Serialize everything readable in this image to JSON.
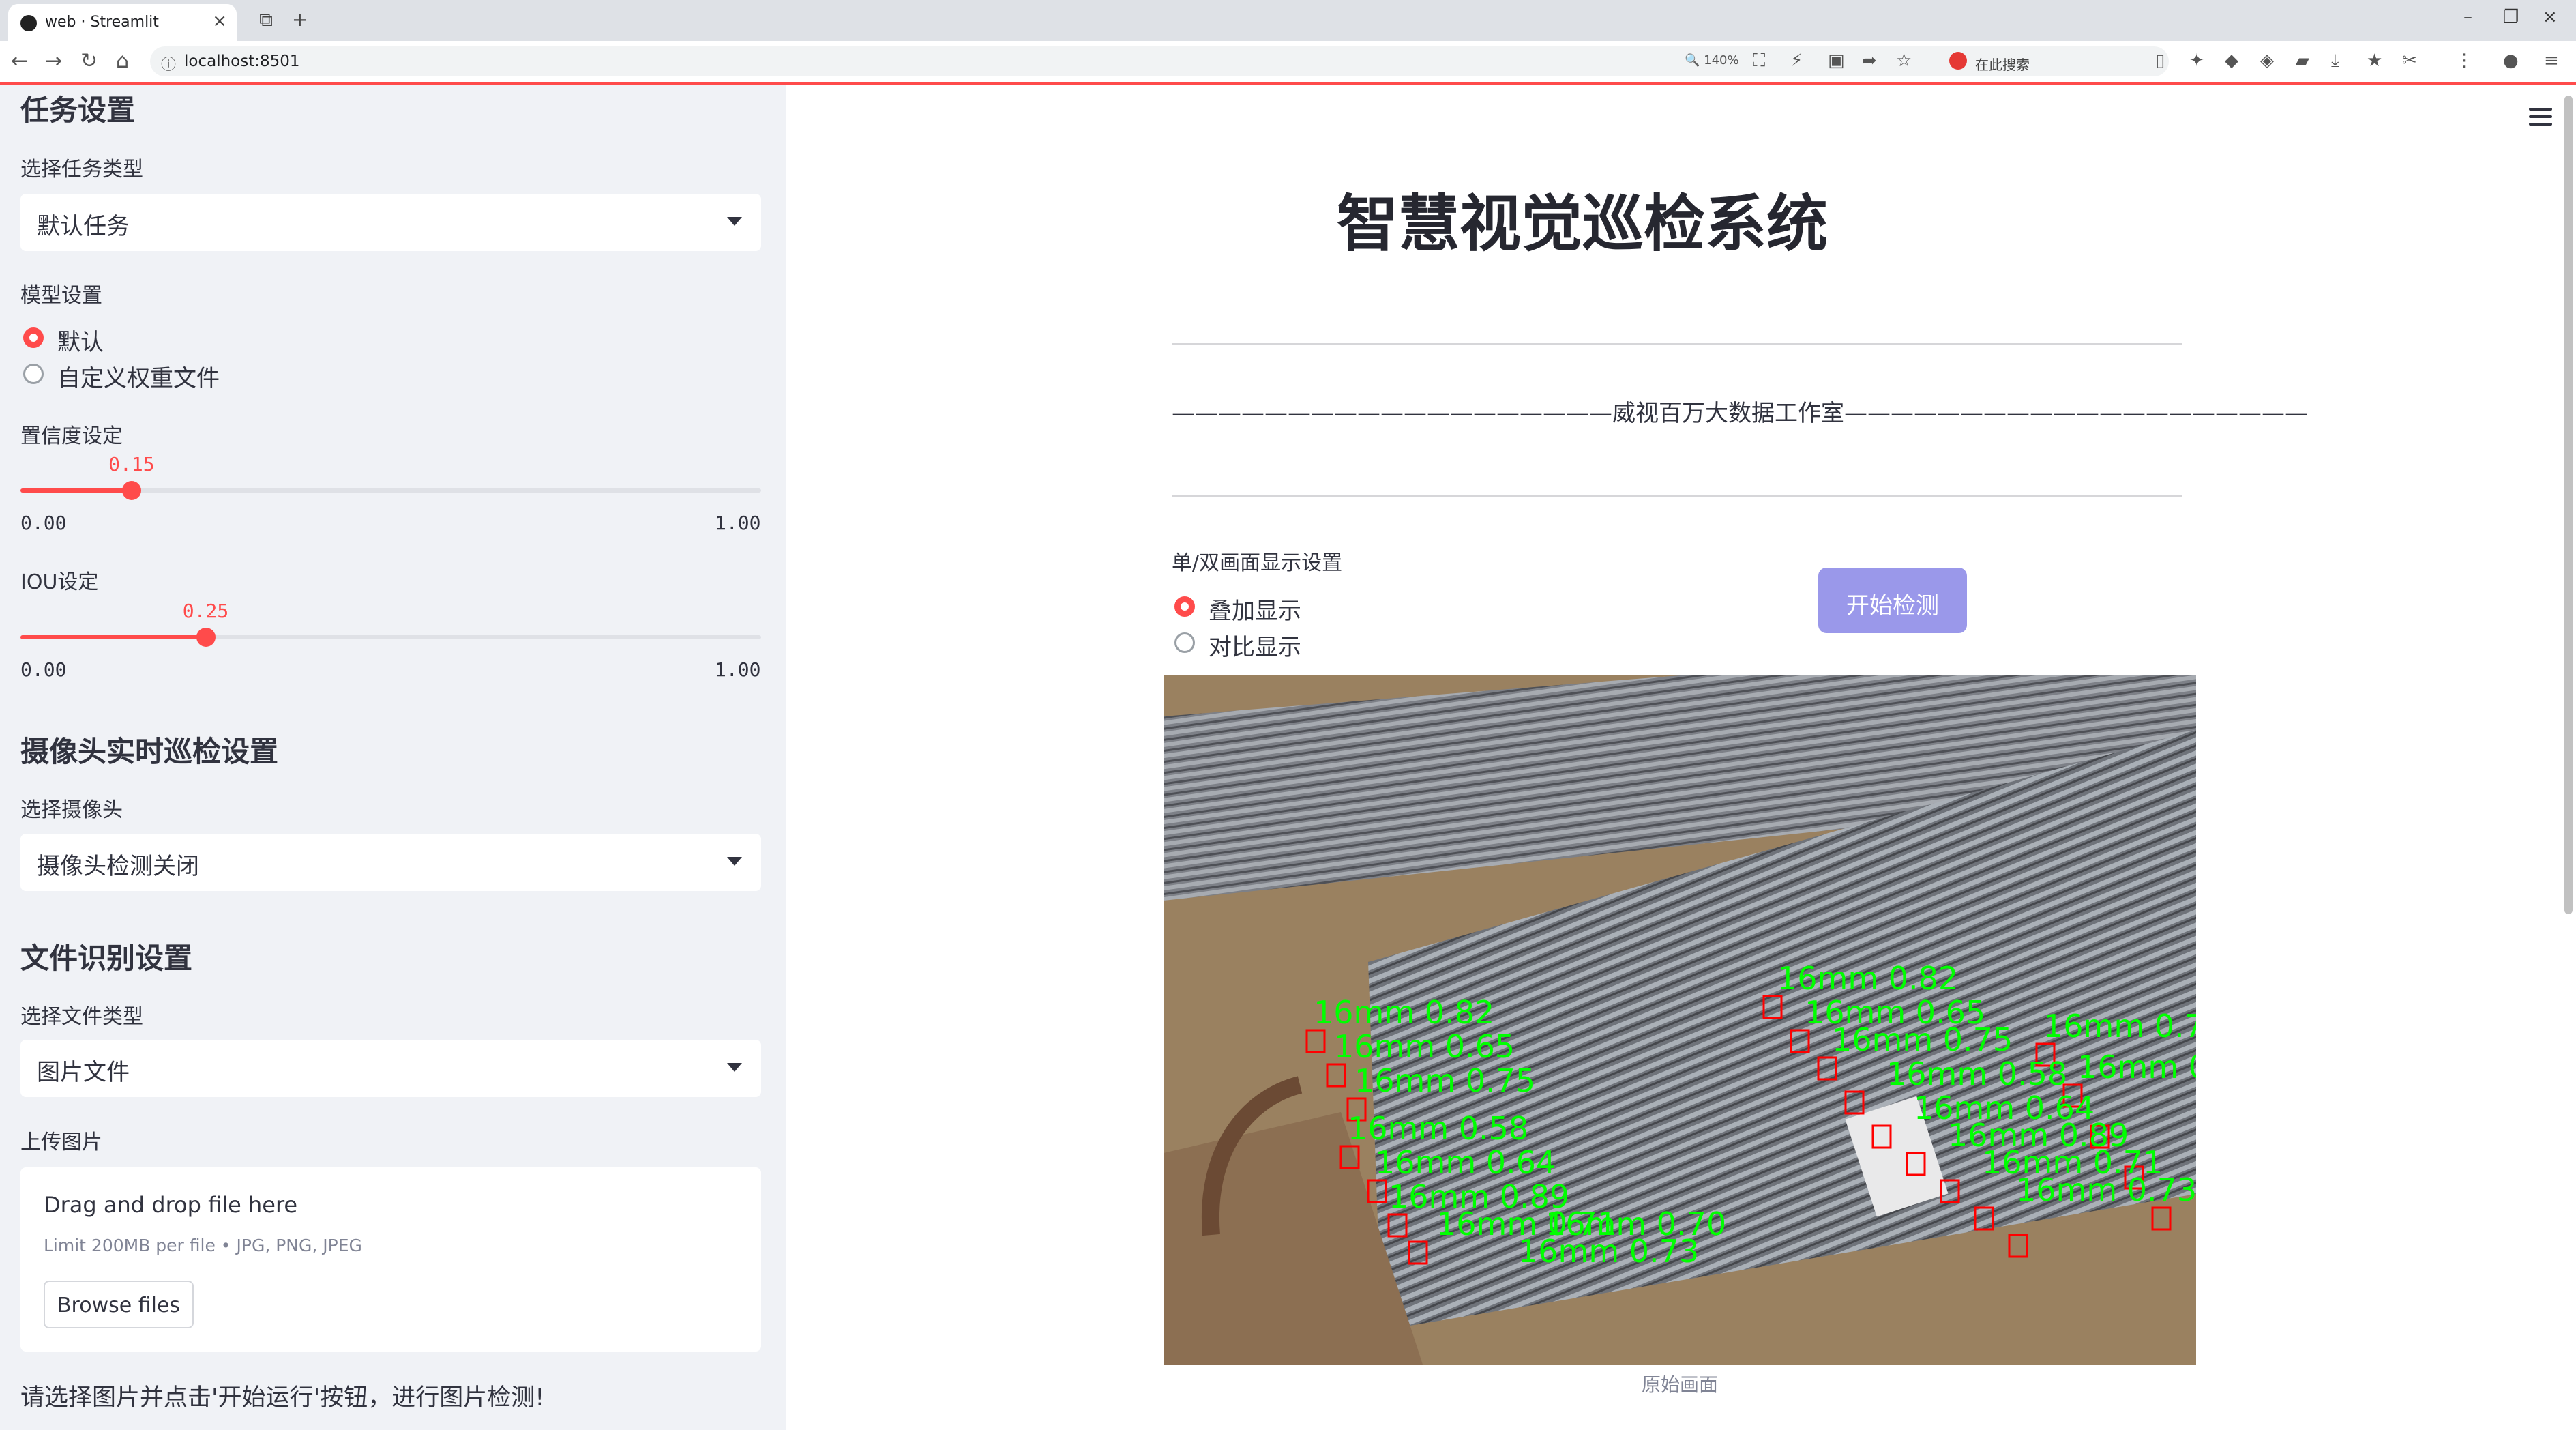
{
  "browser": {
    "tab_title": "web · Streamlit",
    "url": "localhost:8501",
    "zoom": "140%",
    "search_placeholder": "在此搜索"
  },
  "sidebar": {
    "task_section": {
      "title": "任务设置",
      "select_label": "选择任务类型",
      "select_value": "默认任务"
    },
    "model_section": {
      "label": "模型设置",
      "options": [
        {
          "label": "默认",
          "selected": true
        },
        {
          "label": "自定义权重文件",
          "selected": false
        }
      ]
    },
    "confidence": {
      "label": "置信度设定",
      "value": 0.15,
      "value_text": "0.15",
      "min": "0.00",
      "max": "1.00"
    },
    "iou": {
      "label": "IOU设定",
      "value": 0.25,
      "value_text": "0.25",
      "min": "0.00",
      "max": "1.00"
    },
    "camera_section": {
      "title": "摄像头实时巡检设置",
      "select_label": "选择摄像头",
      "select_value": "摄像头检测关闭"
    },
    "file_section": {
      "title": "文件识别设置",
      "select_label": "选择文件类型",
      "select_value": "图片文件",
      "upload_label": "上传图片",
      "drop_text": "Drag and drop file here",
      "limit_text": "Limit 200MB per file • JPG, PNG, JPEG",
      "browse_label": "Browse files"
    },
    "hint": "请选择图片并点击'开始运行'按钮，进行图片检测!"
  },
  "main": {
    "title": "智慧视觉巡检系统",
    "subtitle": "———————————————————威视百万大数据工作室————————————————————",
    "display_label": "单/双画面显示设置",
    "display_options": [
      {
        "label": "叠加显示",
        "selected": true
      },
      {
        "label": "对比显示",
        "selected": false
      }
    ],
    "start_button": "开始检测",
    "image_caption": "原始画面",
    "detection_label": "16mm",
    "detections": [
      "16mm 0.82",
      "16mm 0.65",
      "16mm 0.75",
      "16mm 0.58",
      "16mm 0.64",
      "16mm 0.89",
      "16mm 0.71",
      "16mm 0.73",
      "16mm 0.70"
    ]
  },
  "colors": {
    "accent": "#ff4b4b",
    "sidebar_bg": "#f0f2f6",
    "start_button": "#9a98ea",
    "detection_text": "#00ff00",
    "detection_box": "#ff0000"
  }
}
